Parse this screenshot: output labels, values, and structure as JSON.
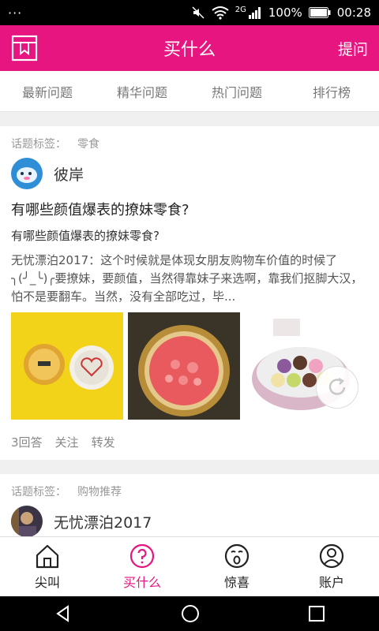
{
  "status_bar": {
    "left": "···",
    "network": "2G",
    "battery": "100%",
    "time": "00:28"
  },
  "header": {
    "title": "买什么",
    "action": "提问"
  },
  "tabs": [
    {
      "label": "最新问题"
    },
    {
      "label": "精华问题"
    },
    {
      "label": "热门问题"
    },
    {
      "label": "排行榜"
    }
  ],
  "cards": [
    {
      "tag_label": "话题标签：",
      "tag_value": "零食",
      "user": "彼岸",
      "title": "有哪些颜值爆表的撩妹零食?",
      "subtitle": "有哪些颜值爆表的撩妹零食?",
      "body": "无忧漂泊2017：这个时候就是体现女朋友购物车价值的时候了╮(╯_╰)╭要撩妹，要颜值，当然得靠妹子来选啊，靠我们抠脚大汉，怕不是要翻车。当然，没有全部吃过，毕...",
      "answers": "3回答",
      "follow": "关注",
      "share": "转发"
    },
    {
      "tag_label": "话题标签：",
      "tag_value": "购物推荐",
      "user": "无忧漂泊2017"
    }
  ],
  "bottom_nav": [
    {
      "label": "尖叫",
      "icon": "home-icon"
    },
    {
      "label": "买什么",
      "icon": "question-icon"
    },
    {
      "label": "惊喜",
      "icon": "surprise-icon"
    },
    {
      "label": "账户",
      "icon": "user-icon"
    }
  ],
  "colors": {
    "brand": "#e6157f",
    "muted": "#999999"
  }
}
